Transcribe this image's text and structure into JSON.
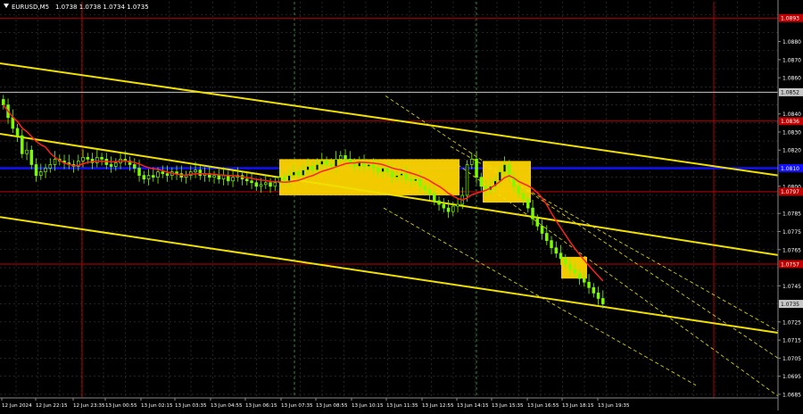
{
  "header": {
    "symbol": "EURUSD,M5",
    "ohlc": "1.0738 1.0738 1.0734 1.0735"
  },
  "colors": {
    "background": "#000000",
    "grid": "#3a3a3a",
    "candle": "#7cfc00",
    "ma": "#ff2020",
    "trend": "#f0e000",
    "level_red": "#c00000",
    "level_blue": "#1010ff",
    "level_white": "#c8c8c8",
    "box": "#ffd500",
    "vline_red": "#b00000",
    "vline_green": "#2e8b2e",
    "axis_text": "#ffffff"
  },
  "chart_data": {
    "type": "candlestick",
    "symbol": "EURUSD",
    "timeframe": "M5",
    "ylim": [
      1.0683,
      1.0902
    ],
    "x_tick_labels": [
      "12 Jun 2024",
      "12 Jun 22:15",
      "12 Jun 23:35",
      "13 Jun 00:55",
      "13 Jun 02:15",
      "13 Jun 03:35",
      "13 Jun 04:55",
      "13 Jun 06:15",
      "13 Jun 07:35",
      "13 Jun 08:55",
      "13 Jun 10:15",
      "13 Jun 11:35",
      "13 Jun 12:55",
      "13 Jun 14:15",
      "13 Jun 15:35",
      "13 Jun 16:55",
      "13 Jun 18:15",
      "13 Jun 19:35"
    ],
    "y_tick_values": [
      "1.0880",
      "1.0870",
      "1.0860",
      "1.0840",
      "1.0830",
      "1.0820",
      "1.0800",
      "1.0785",
      "1.0775",
      "1.0765",
      "1.0745",
      "1.0725",
      "1.0715",
      "1.0705",
      "1.0695",
      "1.0685"
    ],
    "price_level_labels": [
      {
        "value": "1.0893",
        "color": "#c00000"
      },
      {
        "value": "1.0852",
        "color": "#c8c8c8"
      },
      {
        "value": "1.0836",
        "color": "#c00000"
      },
      {
        "value": "1.0810",
        "color": "#1010ff"
      },
      {
        "value": "1.0797",
        "color": "#c00000"
      },
      {
        "value": "1.0757",
        "color": "#c00000"
      },
      {
        "value": "1.0735",
        "color": "#c8c8c8"
      }
    ],
    "current_price": "1.0735",
    "close_path": [
      1.0845,
      1.0838,
      1.0832,
      1.0828,
      1.0818,
      1.082,
      1.0812,
      1.0806,
      1.0808,
      1.081,
      1.0812,
      1.0815,
      1.0814,
      1.0813,
      1.0812,
      1.0811,
      1.0814,
      1.0816,
      1.0815,
      1.0813,
      1.0816,
      1.0815,
      1.0812,
      1.0811,
      1.0813,
      1.0815,
      1.0814,
      1.0812,
      1.081,
      1.0806,
      1.0804,
      1.0806,
      1.0805,
      1.0808,
      1.0807,
      1.0806,
      1.0808,
      1.0807,
      1.0805,
      1.0806,
      1.0808,
      1.0809,
      1.0806,
      1.0807,
      1.0805,
      1.0806,
      1.0804,
      1.0806,
      1.0803,
      1.0805,
      1.0806,
      1.0804,
      1.0803,
      1.0802,
      1.08,
      1.0801,
      1.0802,
      1.08,
      1.0802,
      1.0805,
      1.0803,
      1.0806,
      1.0808,
      1.0806,
      1.0809,
      1.0811,
      1.0809,
      1.0812,
      1.0814,
      1.0812,
      1.0811,
      1.0815,
      1.0817,
      1.0815,
      1.0813,
      1.0811,
      1.0813,
      1.0811,
      1.0812,
      1.081,
      1.0808,
      1.081,
      1.0808,
      1.0805,
      1.0806,
      1.0807,
      1.0804,
      1.0803,
      1.0804,
      1.08,
      1.0798,
      1.0796,
      1.0792,
      1.079,
      1.0788,
      1.0786,
      1.0789,
      1.079,
      1.0795,
      1.0812,
      1.0815,
      1.0805,
      1.08,
      1.0798,
      1.08,
      1.0803,
      1.0808,
      1.0812,
      1.0805,
      1.08,
      1.0796,
      1.0793,
      1.0788,
      1.0782,
      1.0778,
      1.0774,
      1.077,
      1.0766,
      1.0763,
      1.076,
      1.0757,
      1.0754,
      1.0752,
      1.0749,
      1.0747,
      1.0744,
      1.0741,
      1.0738,
      1.0735
    ]
  }
}
